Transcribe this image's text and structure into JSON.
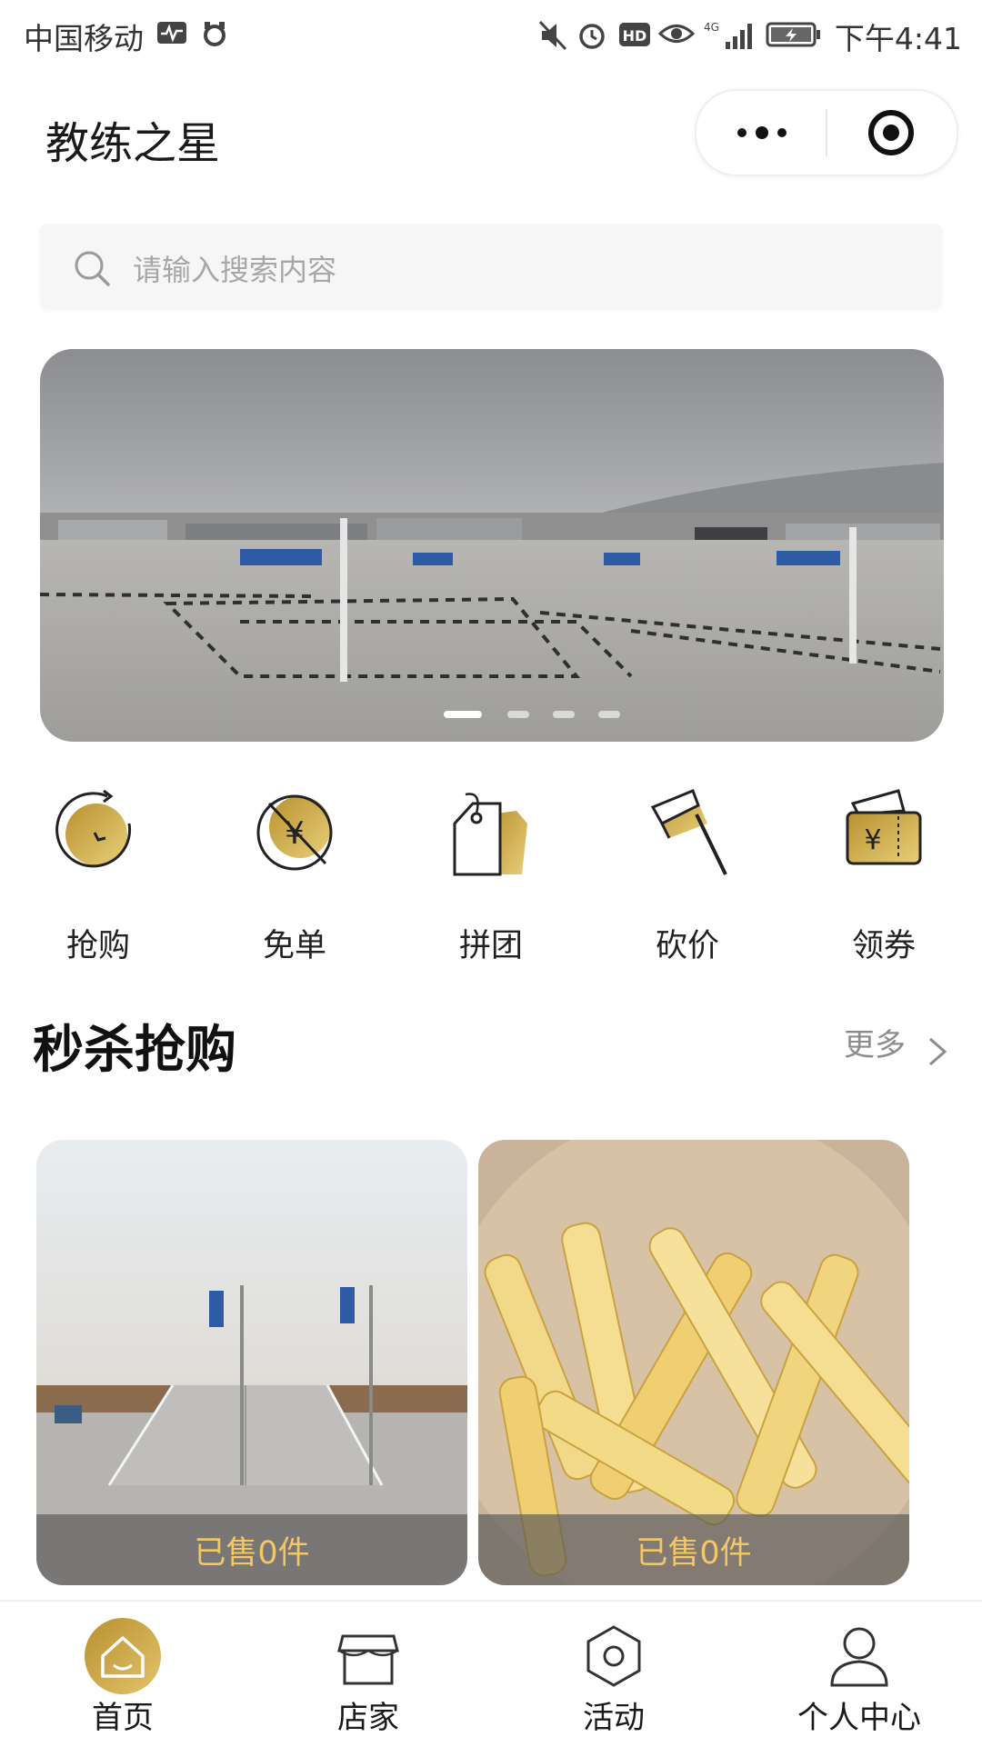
{
  "status_bar": {
    "carrier": "中国移动",
    "network": "4G",
    "time": "下午4:41"
  },
  "header": {
    "title": "教练之星",
    "capsule": {
      "more_icon": "more-dots-icon",
      "close_icon": "target-close-icon"
    }
  },
  "search": {
    "placeholder": "请输入搜索内容",
    "icon": "search-icon"
  },
  "banner": {
    "slide_count": 4,
    "active_index": 0
  },
  "quick_nav": [
    {
      "label": "抢购",
      "icon": "clock-flash-sale-icon"
    },
    {
      "label": "免单",
      "icon": "free-order-icon"
    },
    {
      "label": "拼团",
      "icon": "group-buy-tag-icon"
    },
    {
      "label": "砍价",
      "icon": "bargain-axe-icon"
    },
    {
      "label": "领券",
      "icon": "coupon-icon"
    }
  ],
  "flash_sale": {
    "title": "秒杀抢购",
    "more_label": "更多",
    "products": [
      {
        "sold_text": "已售0件",
        "image": "driving-school-slope-photo"
      },
      {
        "sold_text": "已售0件",
        "image": "french-fries-photo"
      }
    ]
  },
  "tab_bar": [
    {
      "label": "首页",
      "icon": "home-icon",
      "active": true
    },
    {
      "label": "店家",
      "icon": "store-icon",
      "active": false
    },
    {
      "label": "活动",
      "icon": "activity-icon",
      "active": false
    },
    {
      "label": "个人中心",
      "icon": "user-icon",
      "active": false
    }
  ],
  "colors": {
    "accent_gold": "#c9a84c",
    "sold_text": "#f3c768"
  }
}
